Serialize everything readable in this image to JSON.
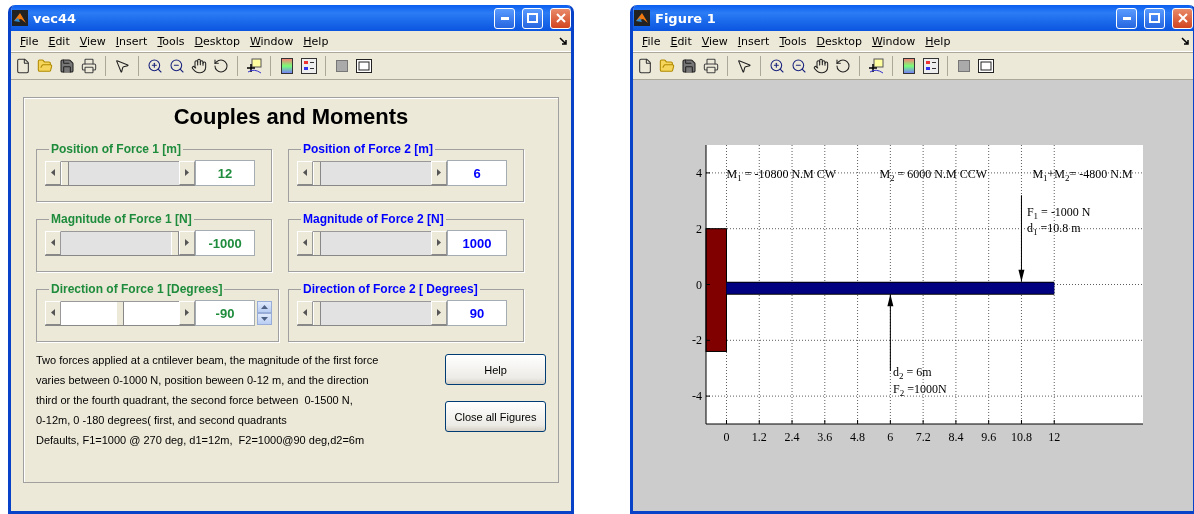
{
  "control_window": {
    "title": "vec44",
    "menu": [
      "File",
      "Edit",
      "View",
      "Insert",
      "Tools",
      "Desktop",
      "Window",
      "Help"
    ],
    "heading": "Couples and Moments",
    "groups": [
      {
        "label": "Position of Force 1 [m]",
        "color": "#1e8c3c",
        "kind": "plain",
        "level": 0,
        "value": "12"
      },
      {
        "label": "Position of Force 2 [m]",
        "color": "#0000ff",
        "kind": "plain",
        "level": 0,
        "value": "6"
      },
      {
        "label": "Magnitude of Force 1 [N]",
        "color": "#1e8c3c",
        "kind": "plain",
        "level": 1,
        "value": "-1000"
      },
      {
        "label": "Magnitude of Force 2 [N]",
        "color": "#0000ff",
        "kind": "plain",
        "level": 0,
        "value": "1000"
      },
      {
        "label": "Direction of Force 1 [Degrees]",
        "color": "#1e8c3c",
        "kind": "spinner",
        "level": 0.5,
        "value": "-90"
      },
      {
        "label": "Direction of Force 2 [ Degrees]",
        "color": "#0000ff",
        "kind": "plain",
        "level": 0,
        "value": "90"
      }
    ],
    "description": [
      "Two forces applied at a cntilever beam, the magnitude of the first force",
      "varies between 0-1000 N, position beween 0-12 m, and the direction",
      "third or the fourth quadrant, the second force between  0-1500 N,",
      "0-12m, 0 -180 degrees( first, and second quadrants",
      "Defaults, F1=1000 @ 270 deg, d1=12m,  F2=1000@90 deg,d2=6m"
    ],
    "buttons": [
      "Help",
      "Close all Figures"
    ]
  },
  "figure_window": {
    "title": "Figure 1",
    "menu": [
      "File",
      "Edit",
      "View",
      "Insert",
      "Tools",
      "Desktop",
      "Window",
      "Help"
    ],
    "plot": {
      "chart_data": {
        "type": "line",
        "xlim": [
          -0.75,
          15.25
        ],
        "ylim": [
          -5,
          5
        ],
        "grid": true,
        "x": [
          0,
          12
        ],
        "series": [
          {
            "color": "#000080",
            "values": [
              -0.13,
              -0.13
            ]
          }
        ],
        "xticks": [
          0,
          1.2,
          2.4,
          3.6,
          4.8,
          6,
          7.2,
          8.4,
          9.6,
          10.8,
          12
        ],
        "yticks": [
          -4,
          -2,
          0,
          2,
          4
        ],
        "annotations": [
          "M$_{1}$ = -10800 N.M CW",
          "M$_{2}$ = 6000 N.M CCW",
          "M$_{1}$+M$_{2}$= -4800 N.M",
          "F$_{1}$ = -1000 N",
          "d$_{1}$ =10.8 m",
          "d$_{2}$ = 6m",
          "F$_{2}$ =1000N"
        ]
      }
    }
  }
}
